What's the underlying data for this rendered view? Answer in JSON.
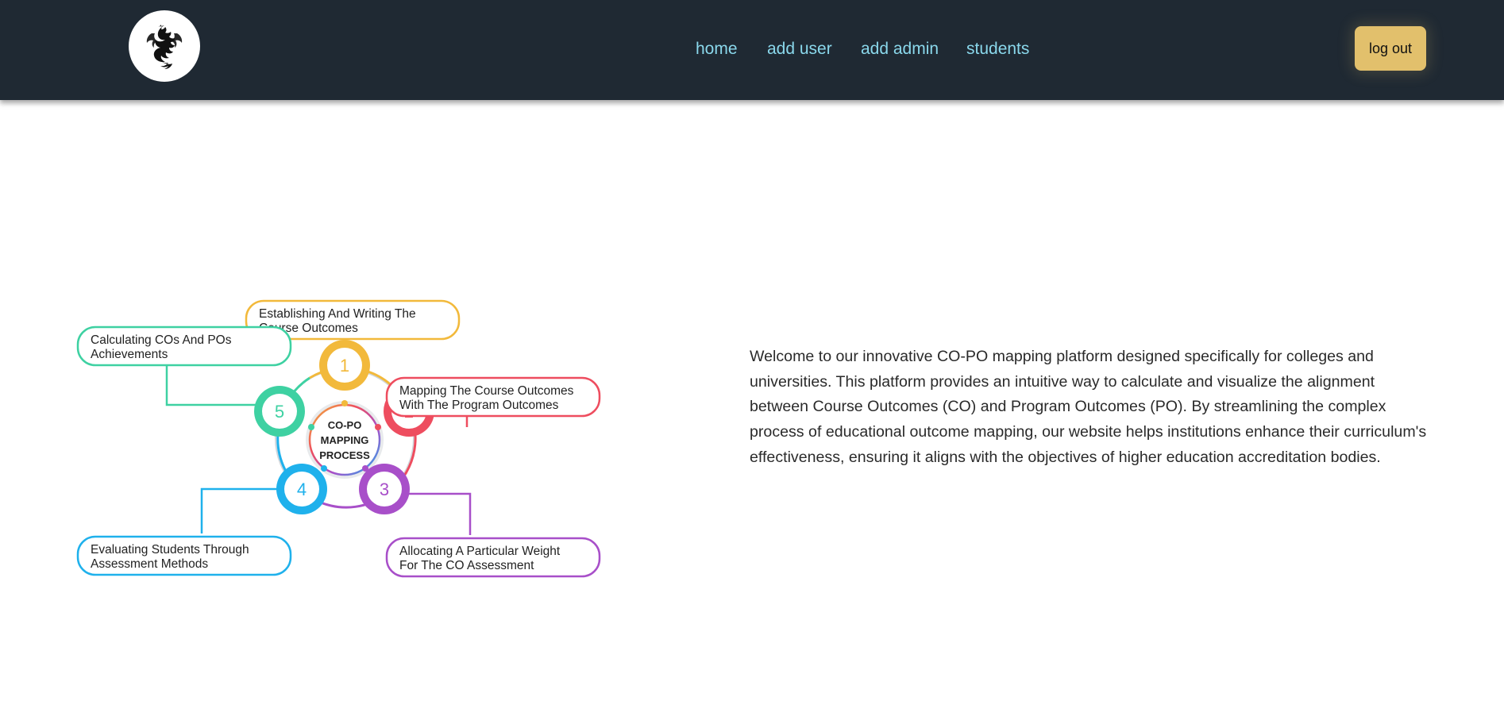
{
  "header": {
    "logo": {
      "icon": "dragon-icon"
    },
    "nav": [
      {
        "id": "home",
        "label": "home"
      },
      {
        "id": "add-user",
        "label": "add user"
      },
      {
        "id": "add-admin",
        "label": "add admin"
      },
      {
        "id": "students",
        "label": "students"
      }
    ],
    "logout_label": "log out"
  },
  "diagram": {
    "center": [
      "CO-PO",
      "MAPPING",
      "PROCESS"
    ],
    "steps": [
      {
        "num": "1",
        "color": "#f2b93b",
        "lines": [
          "Establishing And Writing The",
          "Course Outcomes"
        ]
      },
      {
        "num": "2",
        "color": "#ee4d5f",
        "lines": [
          "Mapping The Course Outcomes",
          "With The Program Outcomes"
        ]
      },
      {
        "num": "3",
        "color": "#a84fc9",
        "lines": [
          "Allocating A Particular Weight",
          "For The CO Assessment"
        ]
      },
      {
        "num": "4",
        "color": "#1fb1ec",
        "lines": [
          "Evaluating Students Through",
          "Assessment Methods"
        ]
      },
      {
        "num": "5",
        "color": "#3ed1a2",
        "lines": [
          "Calculating COs And POs",
          "Achievements"
        ]
      }
    ]
  },
  "intro": {
    "text": "Welcome to our innovative CO-PO mapping platform designed specifically for colleges and universities. This platform provides an intuitive way to calculate and visualize the alignment between Course Outcomes (CO) and Program Outcomes (PO). By streamlining the complex process of educational outcome mapping, our website helps institutions enhance their curriculum's effectiveness, ensuring it aligns with the objectives of higher education accreditation bodies."
  },
  "colors": {
    "header_bg": "#1f2933",
    "nav_link": "#8ad8ec",
    "logout_bg": "#e2c06c"
  }
}
